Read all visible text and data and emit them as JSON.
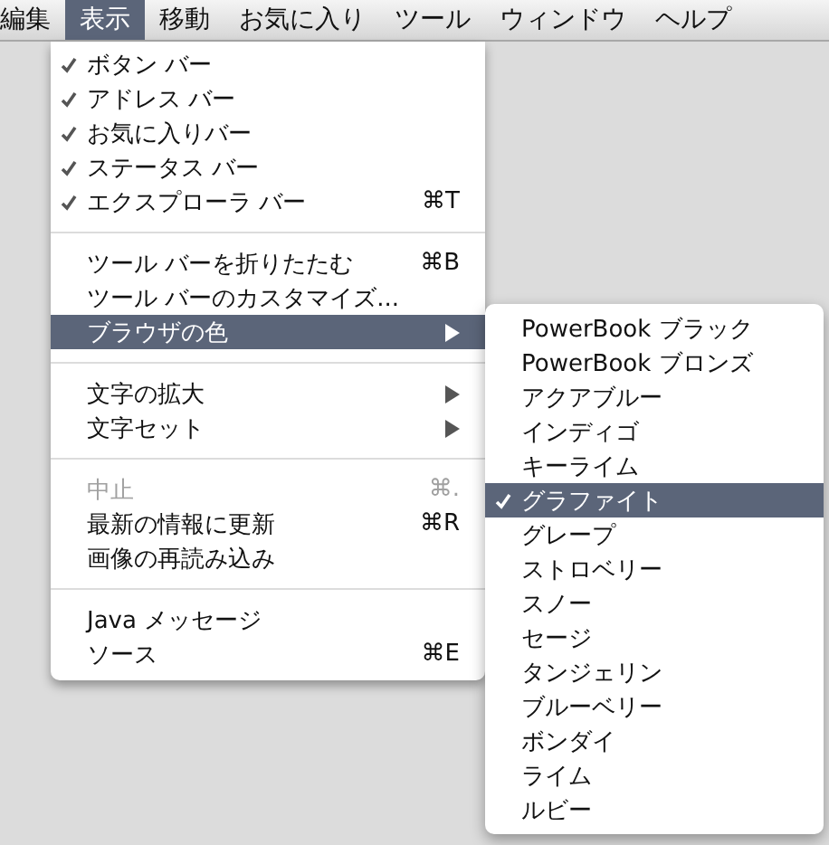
{
  "menubar": [
    {
      "label": "編集",
      "selected": false
    },
    {
      "label": "表示",
      "selected": true
    },
    {
      "label": "移動",
      "selected": false
    },
    {
      "label": "お気に入り",
      "selected": false
    },
    {
      "label": "ツール",
      "selected": false
    },
    {
      "label": "ウィンドウ",
      "selected": false
    },
    {
      "label": "ヘルプ",
      "selected": false
    }
  ],
  "menu": {
    "sections": [
      [
        {
          "label": "ボタン バー",
          "checked": true,
          "disabled": false,
          "selected": false,
          "has_submenu": false
        },
        {
          "label": "アドレス バー",
          "checked": true,
          "disabled": false,
          "selected": false,
          "has_submenu": false
        },
        {
          "label": "お気に入りバー",
          "checked": true,
          "disabled": false,
          "selected": false,
          "has_submenu": false
        },
        {
          "label": "ステータス バー",
          "checked": true,
          "disabled": false,
          "selected": false,
          "has_submenu": false
        },
        {
          "label": "エクスプローラ バー",
          "shortcut": "⌘T",
          "checked": true,
          "disabled": false,
          "selected": false,
          "has_submenu": false
        }
      ],
      [
        {
          "label": "ツール バーを折りたたむ",
          "shortcut": "⌘B",
          "checked": false,
          "disabled": false,
          "selected": false,
          "has_submenu": false
        },
        {
          "label": "ツール バーのカスタマイズ...",
          "checked": false,
          "disabled": false,
          "selected": false,
          "has_submenu": false
        },
        {
          "label": "ブラウザの色",
          "checked": false,
          "disabled": false,
          "selected": true,
          "has_submenu": true
        }
      ],
      [
        {
          "label": "文字の拡大",
          "checked": false,
          "disabled": false,
          "selected": false,
          "has_submenu": true
        },
        {
          "label": "文字セット",
          "checked": false,
          "disabled": false,
          "selected": false,
          "has_submenu": true
        }
      ],
      [
        {
          "label": "中止",
          "shortcut": "⌘.",
          "checked": false,
          "disabled": true,
          "selected": false,
          "has_submenu": false
        },
        {
          "label": "最新の情報に更新",
          "shortcut": "⌘R",
          "checked": false,
          "disabled": false,
          "selected": false,
          "has_submenu": false
        },
        {
          "label": "画像の再読み込み",
          "checked": false,
          "disabled": false,
          "selected": false,
          "has_submenu": false
        }
      ],
      [
        {
          "label": "Java メッセージ",
          "checked": false,
          "disabled": false,
          "selected": false,
          "has_submenu": false
        },
        {
          "label": "ソース",
          "shortcut": "⌘E",
          "checked": false,
          "disabled": false,
          "selected": false,
          "has_submenu": false
        }
      ]
    ]
  },
  "submenu": {
    "items": [
      {
        "label": "PowerBook ブラック",
        "checked": false,
        "selected": false
      },
      {
        "label": "PowerBook ブロンズ",
        "checked": false,
        "selected": false
      },
      {
        "label": "アクアブルー",
        "checked": false,
        "selected": false
      },
      {
        "label": "インディゴ",
        "checked": false,
        "selected": false
      },
      {
        "label": "キーライム",
        "checked": false,
        "selected": false
      },
      {
        "label": "グラファイト",
        "checked": true,
        "selected": true
      },
      {
        "label": "グレープ",
        "checked": false,
        "selected": false
      },
      {
        "label": "ストロベリー",
        "checked": false,
        "selected": false
      },
      {
        "label": "スノー",
        "checked": false,
        "selected": false
      },
      {
        "label": "セージ",
        "checked": false,
        "selected": false
      },
      {
        "label": "タンジェリン",
        "checked": false,
        "selected": false
      },
      {
        "label": "ブルーベリー",
        "checked": false,
        "selected": false
      },
      {
        "label": "ボンダイ",
        "checked": false,
        "selected": false
      },
      {
        "label": "ライム",
        "checked": false,
        "selected": false
      },
      {
        "label": "ルビー",
        "checked": false,
        "selected": false
      }
    ]
  }
}
